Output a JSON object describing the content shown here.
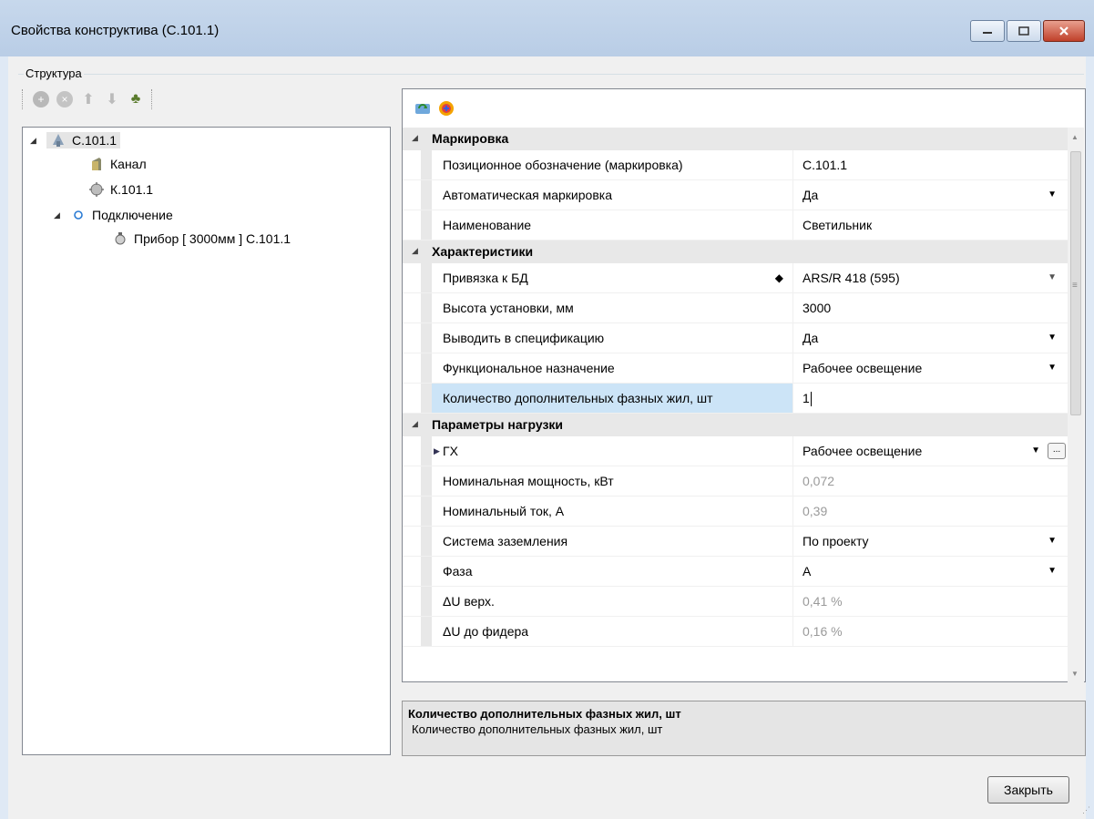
{
  "window": {
    "title": "Свойства конструктива (С.101.1)"
  },
  "structure": {
    "group_label": "Структура"
  },
  "tree": {
    "items": [
      {
        "label": "С.101.1"
      },
      {
        "label": "Канал"
      },
      {
        "label": "К.101.1"
      },
      {
        "label": "Подключение"
      },
      {
        "label": "Прибор [ 3000мм ] С.101.1"
      }
    ]
  },
  "grid": {
    "categories": {
      "marking": "Маркировка",
      "characteristics": "Характеристики",
      "load": "Параметры нагрузки"
    },
    "rows": [
      {
        "name": "Позиционное обозначение (маркировка)",
        "value": "С.101.1"
      },
      {
        "name": "Автоматическая маркировка",
        "value": "Да"
      },
      {
        "name": "Наименование",
        "value": "Светильник"
      },
      {
        "name": "Привязка к БД",
        "value": "ARS/R 418 (595)"
      },
      {
        "name": "Высота установки, мм",
        "value": "3000"
      },
      {
        "name": "Выводить в спецификацию",
        "value": "Да"
      },
      {
        "name": "Функциональное назначение",
        "value": "Рабочее освещение"
      },
      {
        "name": "Количество дополнительных фазных жил, шт",
        "value": "1"
      },
      {
        "name": "ГХ",
        "value": "Рабочее освещение"
      },
      {
        "name": "Номинальная мощность, кВт",
        "value": "0,072"
      },
      {
        "name": "Номинальный ток, А",
        "value": "0,39"
      },
      {
        "name": "Система заземления",
        "value": "По проекту"
      },
      {
        "name": "Фаза",
        "value": "А"
      },
      {
        "name": "ΔU верх.",
        "value": "0,41 %"
      },
      {
        "name": "ΔU до фидера",
        "value": "0,16 %"
      }
    ]
  },
  "description": {
    "title": "Количество дополнительных фазных жил, шт",
    "text": "Количество дополнительных фазных жил, шт"
  },
  "buttons": {
    "close": "Закрыть",
    "ellipsis": "..."
  },
  "colors": {
    "selected_row": "#cce4f7",
    "category_bg": "#e8e8e8",
    "titlebar": "#c7d8ec"
  }
}
